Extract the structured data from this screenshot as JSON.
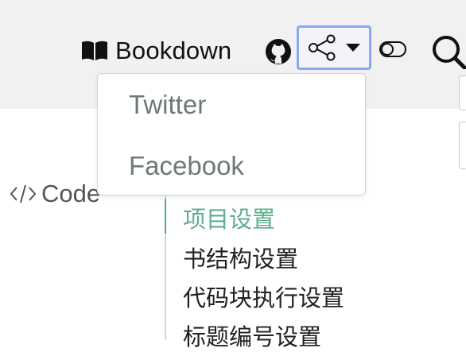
{
  "header": {
    "brand_label": "Bookdown",
    "brand_icon": "book-icon",
    "github_icon": "github-icon",
    "share_icon": "share-icon",
    "caret_icon": "caret-down-icon",
    "toggle_icon": "toggle-icon",
    "search_icon": "search-icon"
  },
  "share_menu": {
    "items": [
      {
        "label": "Twitter"
      },
      {
        "label": "Facebook"
      }
    ]
  },
  "sidebar": {
    "code_label": "Code",
    "code_icon": "code-icon"
  },
  "toc": {
    "items": [
      {
        "label": "项目设置",
        "active": true
      },
      {
        "label": "书结构设置"
      },
      {
        "label": "代码块执行设置"
      },
      {
        "label": "标题编号设置"
      }
    ]
  },
  "colors": {
    "topbar_bg": "#f1f1f2",
    "share_border": "#8aa7f2",
    "active_toc": "#5fae8f",
    "menu_text": "#6e7a74"
  }
}
